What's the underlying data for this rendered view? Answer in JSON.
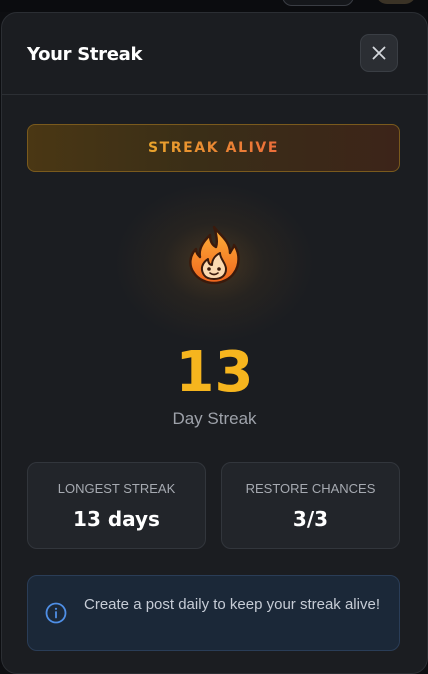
{
  "panel": {
    "title": "Your Streak",
    "close_icon": "close-icon"
  },
  "status": {
    "label": "STREAK ALIVE"
  },
  "streak": {
    "icon": "flame-icon",
    "count": "13",
    "label": "Day Streak"
  },
  "stats": [
    {
      "label": "LONGEST STREAK",
      "value": "13 days"
    },
    {
      "label": "RESTORE CHANCES",
      "value": "3/3"
    }
  ],
  "info": {
    "icon": "info-icon",
    "text": "Create a post daily to keep your streak alive!"
  },
  "colors": {
    "accent": "#f6b51e",
    "status_start": "#e9a42c",
    "status_end": "#ec6d3a",
    "panel_bg": "#1b1d21",
    "info_bg": "#1b2838"
  }
}
